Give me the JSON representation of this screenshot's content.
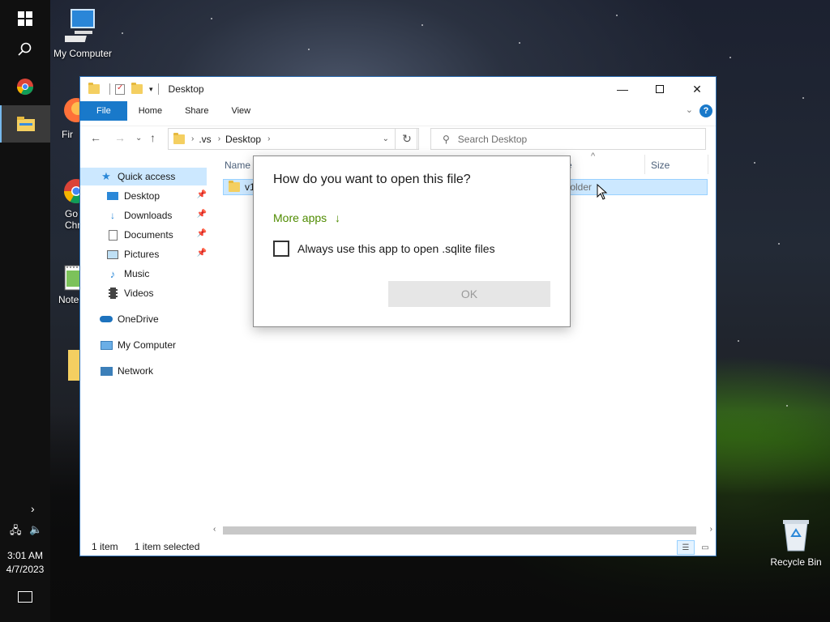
{
  "desktop": {
    "icons": [
      {
        "label": "My Computer",
        "icon": "computer-icon"
      },
      {
        "label": "Fir",
        "icon": "firefox-icon"
      },
      {
        "label": "Go",
        "label2": "Chr",
        "icon": "chrome-icon"
      },
      {
        "label": "Note",
        "icon": "notepad-icon"
      },
      {
        "label": "Recycle Bin",
        "icon": "recycle-bin-icon"
      }
    ]
  },
  "taskbar": {
    "time": "3:01 AM",
    "date": "4/7/2023",
    "buttons": [
      {
        "name": "start",
        "icon": "windows-logo-icon"
      },
      {
        "name": "search",
        "icon": "search-icon"
      },
      {
        "name": "chrome",
        "icon": "chrome-icon"
      },
      {
        "name": "explorer",
        "icon": "file-explorer-icon",
        "active": true
      }
    ]
  },
  "explorer": {
    "title": "Desktop",
    "ribbon_tabs": [
      "File",
      "Home",
      "Share",
      "View"
    ],
    "address": {
      "segments": [
        ".vs",
        "Desktop"
      ]
    },
    "search_placeholder": "Search Desktop",
    "sidebar": {
      "quick_access": "Quick access",
      "items": [
        {
          "label": "Desktop",
          "pinned": true
        },
        {
          "label": "Downloads",
          "pinned": true
        },
        {
          "label": "Documents",
          "pinned": true
        },
        {
          "label": "Pictures",
          "pinned": true
        },
        {
          "label": "Music",
          "pinned": false
        },
        {
          "label": "Videos",
          "pinned": false
        }
      ],
      "onedrive": "OneDrive",
      "my_computer": "My Computer",
      "network": "Network"
    },
    "columns": {
      "name": "Name",
      "type_partial": "e",
      "size": "Size"
    },
    "rows": [
      {
        "name_partial": "v15",
        "type_partial": "folder"
      }
    ],
    "status": {
      "count": "1 item",
      "selected": "1 item selected"
    }
  },
  "dialog": {
    "title": "How do you want to open this file?",
    "more_apps": "More apps",
    "more_apps_arrow": "↓",
    "checkbox_label": "Always use this app to open .sqlite files",
    "checkbox_checked": false,
    "ok_label": "OK"
  },
  "colors": {
    "accent": "#1979ca",
    "selection": "#cce8ff",
    "link_green": "#4f8b00"
  }
}
